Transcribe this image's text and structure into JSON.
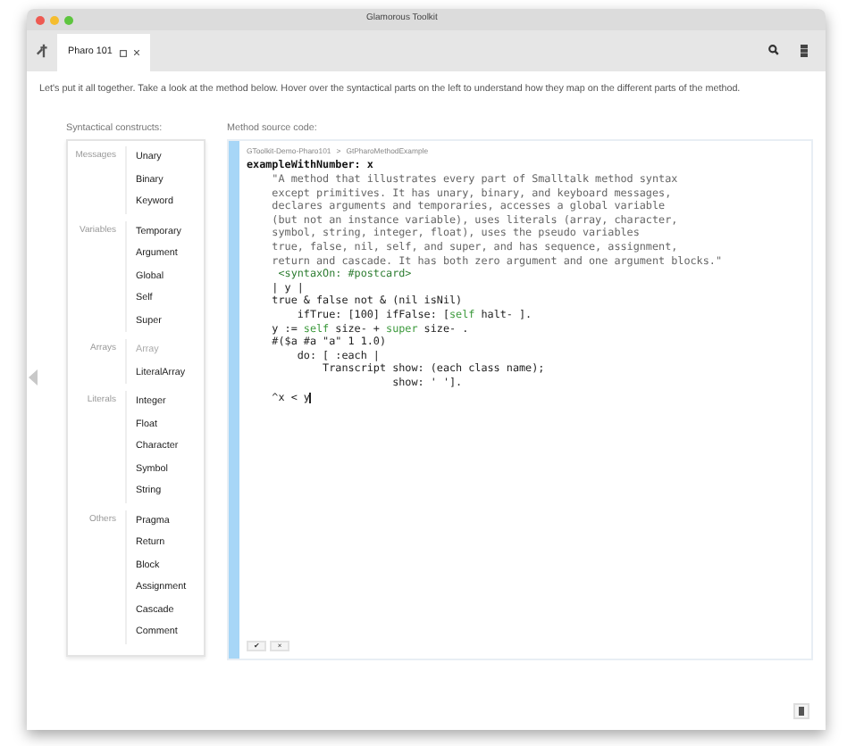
{
  "window": {
    "title": "Glamorous Toolkit"
  },
  "tabs": [
    {
      "label": "Pharo 101",
      "selected": true
    }
  ],
  "intro": "Let's put it all together. Take a look at the method below. Hover over the syntactical parts on the left to understand how they map on the different parts of the method.",
  "constructs": {
    "title": "Syntactical constructs:",
    "groups": [
      {
        "label": "Messages",
        "items": [
          {
            "label": "Unary",
            "disabled": false
          },
          {
            "label": "Binary",
            "disabled": false
          },
          {
            "label": "Keyword",
            "disabled": false
          }
        ]
      },
      {
        "label": "Variables",
        "items": [
          {
            "label": "Temporary",
            "disabled": false
          },
          {
            "label": "Argument",
            "disabled": false
          },
          {
            "label": "Global",
            "disabled": false
          },
          {
            "label": "Self",
            "disabled": false
          },
          {
            "label": "Super",
            "disabled": false
          }
        ]
      },
      {
        "label": "Arrays",
        "items": [
          {
            "label": "Array",
            "disabled": true
          },
          {
            "label": "LiteralArray",
            "disabled": false
          }
        ]
      },
      {
        "label": "Literals",
        "items": [
          {
            "label": "Integer",
            "disabled": false
          },
          {
            "label": "Float",
            "disabled": false
          },
          {
            "label": "Character",
            "disabled": false
          },
          {
            "label": "Symbol",
            "disabled": false
          },
          {
            "label": "String",
            "disabled": false
          }
        ]
      },
      {
        "label": "Others",
        "items": [
          {
            "label": "Pragma",
            "disabled": false
          },
          {
            "label": "Return",
            "disabled": false
          },
          {
            "label": "Block",
            "disabled": false
          },
          {
            "label": "Assignment",
            "disabled": false
          },
          {
            "label": "Cascade",
            "disabled": false
          },
          {
            "label": "Comment",
            "disabled": false
          }
        ]
      }
    ]
  },
  "editor": {
    "title": "Method source code:",
    "breadcrumb": [
      "GToolkit-Demo-Pharo101",
      ">",
      "GtPharoMethodExample"
    ],
    "lines": [
      [
        {
          "kind": "selector",
          "text": "exampleWithNumber: x"
        }
      ],
      [
        {
          "kind": "comment",
          "text": "    \"A method that illustrates every part of Smalltalk method syntax"
        }
      ],
      [
        {
          "kind": "comment",
          "text": "    except primitives. It has unary, binary, and keyboard messages,"
        }
      ],
      [
        {
          "kind": "comment",
          "text": "    declares arguments and temporaries, accesses a global variable"
        }
      ],
      [
        {
          "kind": "comment",
          "text": "    (but not an instance variable), uses literals (array, character,"
        }
      ],
      [
        {
          "kind": "comment",
          "text": "    symbol, string, integer, float), uses the pseudo variables"
        }
      ],
      [
        {
          "kind": "comment",
          "text": "    true, false, nil, self, and super, and has sequence, assignment,"
        }
      ],
      [
        {
          "kind": "comment",
          "text": "    return and cascade. It has both zero argument and one argument blocks.\""
        }
      ],
      [
        {
          "kind": "pragma",
          "text": "     <syntaxOn: #postcard>"
        }
      ],
      [
        {
          "kind": "plain",
          "text": "    | y |"
        }
      ],
      [
        {
          "kind": "plain",
          "text": "    true & false not & (nil isNil)"
        }
      ],
      [
        {
          "kind": "plain",
          "text": "        ifTrue: [100] ifFalse: ["
        },
        {
          "kind": "pseudo",
          "text": "self"
        },
        {
          "kind": "plain",
          "text": " halt- ]."
        }
      ],
      [
        {
          "kind": "plain",
          "text": "    y := "
        },
        {
          "kind": "pseudo",
          "text": "self"
        },
        {
          "kind": "plain",
          "text": " size- + "
        },
        {
          "kind": "pseudo",
          "text": "super"
        },
        {
          "kind": "plain",
          "text": " size- ."
        }
      ],
      [
        {
          "kind": "plain",
          "text": "    #($a #a \"a\" 1 1.0)"
        }
      ],
      [
        {
          "kind": "plain",
          "text": "        do: [ :each |"
        }
      ],
      [
        {
          "kind": "plain",
          "text": "            Transcript show: (each class name);"
        }
      ],
      [
        {
          "kind": "plain",
          "text": "                       show: ' ']."
        }
      ],
      [
        {
          "kind": "plain",
          "text": "    ^x < y"
        }
      ]
    ],
    "actions": [
      "✔",
      "×"
    ]
  }
}
